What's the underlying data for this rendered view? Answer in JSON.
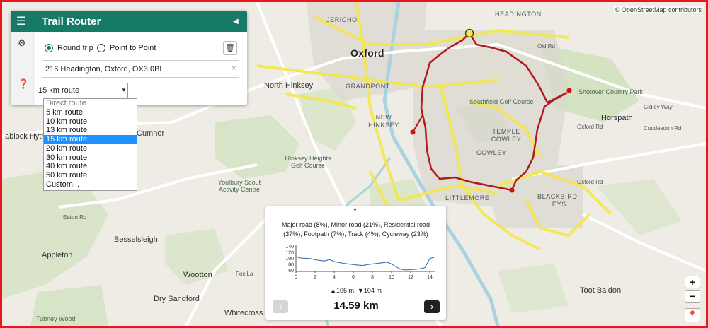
{
  "attribution": "© OpenStreetMap contributors",
  "panel": {
    "title": "Trail Router",
    "menu_icon": "menu-icon",
    "collapse_icon": "collapse-left-icon",
    "round_trip_label": "Round trip",
    "point_to_point_label": "Point to Point",
    "mode_selected": "Round trip",
    "address_value": "216 Headington, Oxford, OX3 0BL",
    "route_value": "15 km route",
    "route_options": [
      "Direct route",
      "5 km route",
      "10 km route",
      "13 km route",
      "15 km route",
      "20 km route",
      "30 km route",
      "40 km route",
      "50 km route",
      "Custom..."
    ],
    "route_selected_index": 4,
    "accent_color": "#157a66"
  },
  "map": {
    "route_color": "#b01a1a",
    "road_color": "#f5e74a",
    "labels": {
      "oxford": "Oxford",
      "headington": "HEADINGTON",
      "jericho": "JERICHO",
      "grandpont": "GRANDPONT",
      "new_hinksey": "NEW HINKSEY",
      "north_hinksey": "North Hinksey",
      "hinksey_heights": "Hinksey Heights Golf Course",
      "youlbury": "Youlbury Scout Activity Centre",
      "besselsleigh": "Besselsleigh",
      "appleton": "Appleton",
      "wootton": "Wootton",
      "dry_sandford": "Dry Sandford",
      "tubney_wood": "Tubney Wood",
      "whitecross": "Whitecross",
      "southfield": "Southfield Golf Course",
      "temple_cowley": "TEMPLE COWLEY",
      "cowley": "COWLEY",
      "littlemore": "LITTLEMORE",
      "blackbird_leys": "BLACKBIRD LEYS",
      "shotover": "Shotover Country Park",
      "horspath": "Horspath",
      "toot_baldon": "Toot Baldon",
      "cumnor": "Cumnor",
      "farmoor": "ablock Hyth",
      "oxford_rd_1": "Oxford Rd",
      "oxford_rd_2": "Oxford Rd",
      "cuddesdon_rd": "Cuddesdon Rd",
      "gidley_way": "Gidley Way",
      "old_rd": "Old Rd",
      "eaton_rd": "Eaton Rd",
      "foxcombe": "Fox La"
    }
  },
  "elevation": {
    "toggle_icon": "collapse-down-icon",
    "summary": "Major road (8%), Minor road (21%), Residential road (37%), Footpath (7%), Track (4%), Cycleway (23%)",
    "gain_loss": "▲106 m, ▼104 m",
    "distance": "14.59 km",
    "prev_icon": "chevron-left-icon",
    "next_icon": "chevron-right-icon"
  },
  "chart_data": {
    "type": "line",
    "x": [
      0,
      0.5,
      1,
      1.5,
      2,
      2.5,
      3,
      3.5,
      4,
      4.5,
      5,
      5.5,
      6,
      6.5,
      7,
      7.5,
      8,
      8.5,
      9,
      9.5,
      10,
      10.5,
      11,
      11.5,
      12,
      12.5,
      13,
      13.5,
      14,
      14.59
    ],
    "series": [
      {
        "values": [
          104,
          100,
          99,
          98,
          94,
          92,
          90,
          95,
          88,
          85,
          82,
          80,
          78,
          76,
          75,
          78,
          80,
          82,
          84,
          86,
          80,
          70,
          62,
          60,
          61,
          62,
          64,
          68,
          98,
          104
        ]
      }
    ],
    "x_ticks": [
      0,
      2,
      4,
      6,
      8,
      10,
      12,
      14
    ],
    "y_ticks": [
      60,
      80,
      100,
      120,
      140
    ],
    "xlim": [
      0,
      14.59
    ],
    "ylim": [
      55,
      145
    ],
    "line_color": "#3b6fb6"
  },
  "controls": {
    "zoom_in": "+",
    "zoom_out": "−",
    "locate_icon": "location-pin-icon"
  }
}
